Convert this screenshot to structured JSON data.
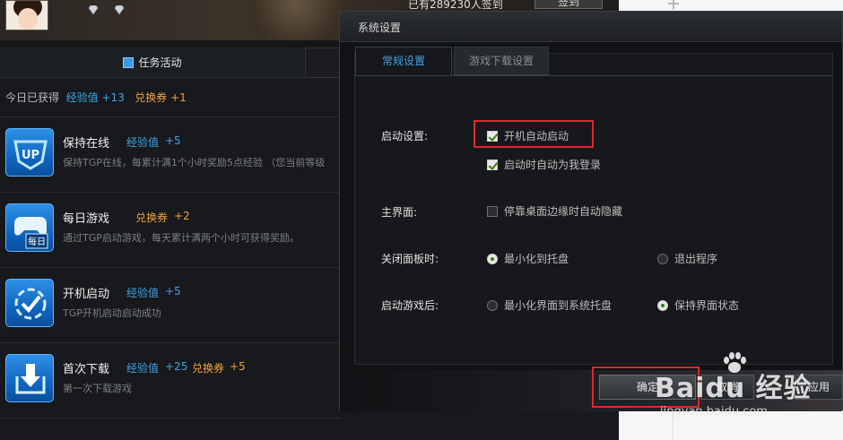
{
  "app": {
    "signin_text": "已有289230人签到",
    "signin_button": "签到"
  },
  "task_panel": {
    "header": "任务活动",
    "today": {
      "prefix": "今日已获得",
      "exp_label": "经验值",
      "exp_value": "+13",
      "coupon_label": "兑换券",
      "coupon_value": "+1"
    },
    "tasks": [
      {
        "icon": "up-badge-icon",
        "name": "保持在线",
        "reward1_label": "经验值",
        "reward1_value": "+5",
        "desc": "保持TGP在线，每累计满1个小时奖励5点经验 （您当前等级"
      },
      {
        "icon": "gamepad-daily-icon",
        "name": "每日游戏",
        "reward1_label": "兑换券",
        "reward1_value": "+2",
        "desc": "通过TGP启动游戏，每天累计满两个小时可获得奖励。"
      },
      {
        "icon": "power-check-icon",
        "name": "开机启动",
        "reward1_label": "经验值",
        "reward1_value": "+5",
        "desc": "TGP开机启动启动成功"
      },
      {
        "icon": "download-icon",
        "name": "首次下载",
        "reward1_label": "经验值",
        "reward1_value": "+25",
        "reward2_label": "兑换券",
        "reward2_value": "+5",
        "desc": "第一次下载游戏"
      }
    ]
  },
  "dialog": {
    "title": "系统设置",
    "tabs": {
      "general": "常规设置",
      "download": "游戏下载设置"
    },
    "startup": {
      "label": "启动设置:",
      "auto_start": {
        "text": "开机自动启动",
        "checked": true
      },
      "auto_login": {
        "text": "启动时自动为我登录",
        "checked": true
      }
    },
    "main_ui": {
      "label": "主界面:",
      "auto_hide": {
        "text": "停靠桌面边缘时自动隐藏",
        "checked": false
      }
    },
    "close_panel": {
      "label": "关闭面板时:",
      "option_tray": {
        "text": "最小化到托盘",
        "selected": true
      },
      "option_exit": {
        "text": "退出程序",
        "selected": false
      }
    },
    "after_launch": {
      "label": "启动游戏后:",
      "option_minimize": {
        "text": "最小化界面到系统托盘",
        "selected": false
      },
      "option_keep": {
        "text": "保持界面状态",
        "selected": true
      }
    },
    "buttons": {
      "ok": "确定",
      "cancel": "取消",
      "apply": "应用"
    }
  },
  "watermark": {
    "text": "Baidu 经验",
    "url": "jingyan.baidu.com"
  },
  "colors": {
    "accent_blue": "#3fa3e6",
    "reward_orange": "#f0a23a",
    "highlight_red": "#e0272b",
    "check_green": "#3b7d12"
  }
}
